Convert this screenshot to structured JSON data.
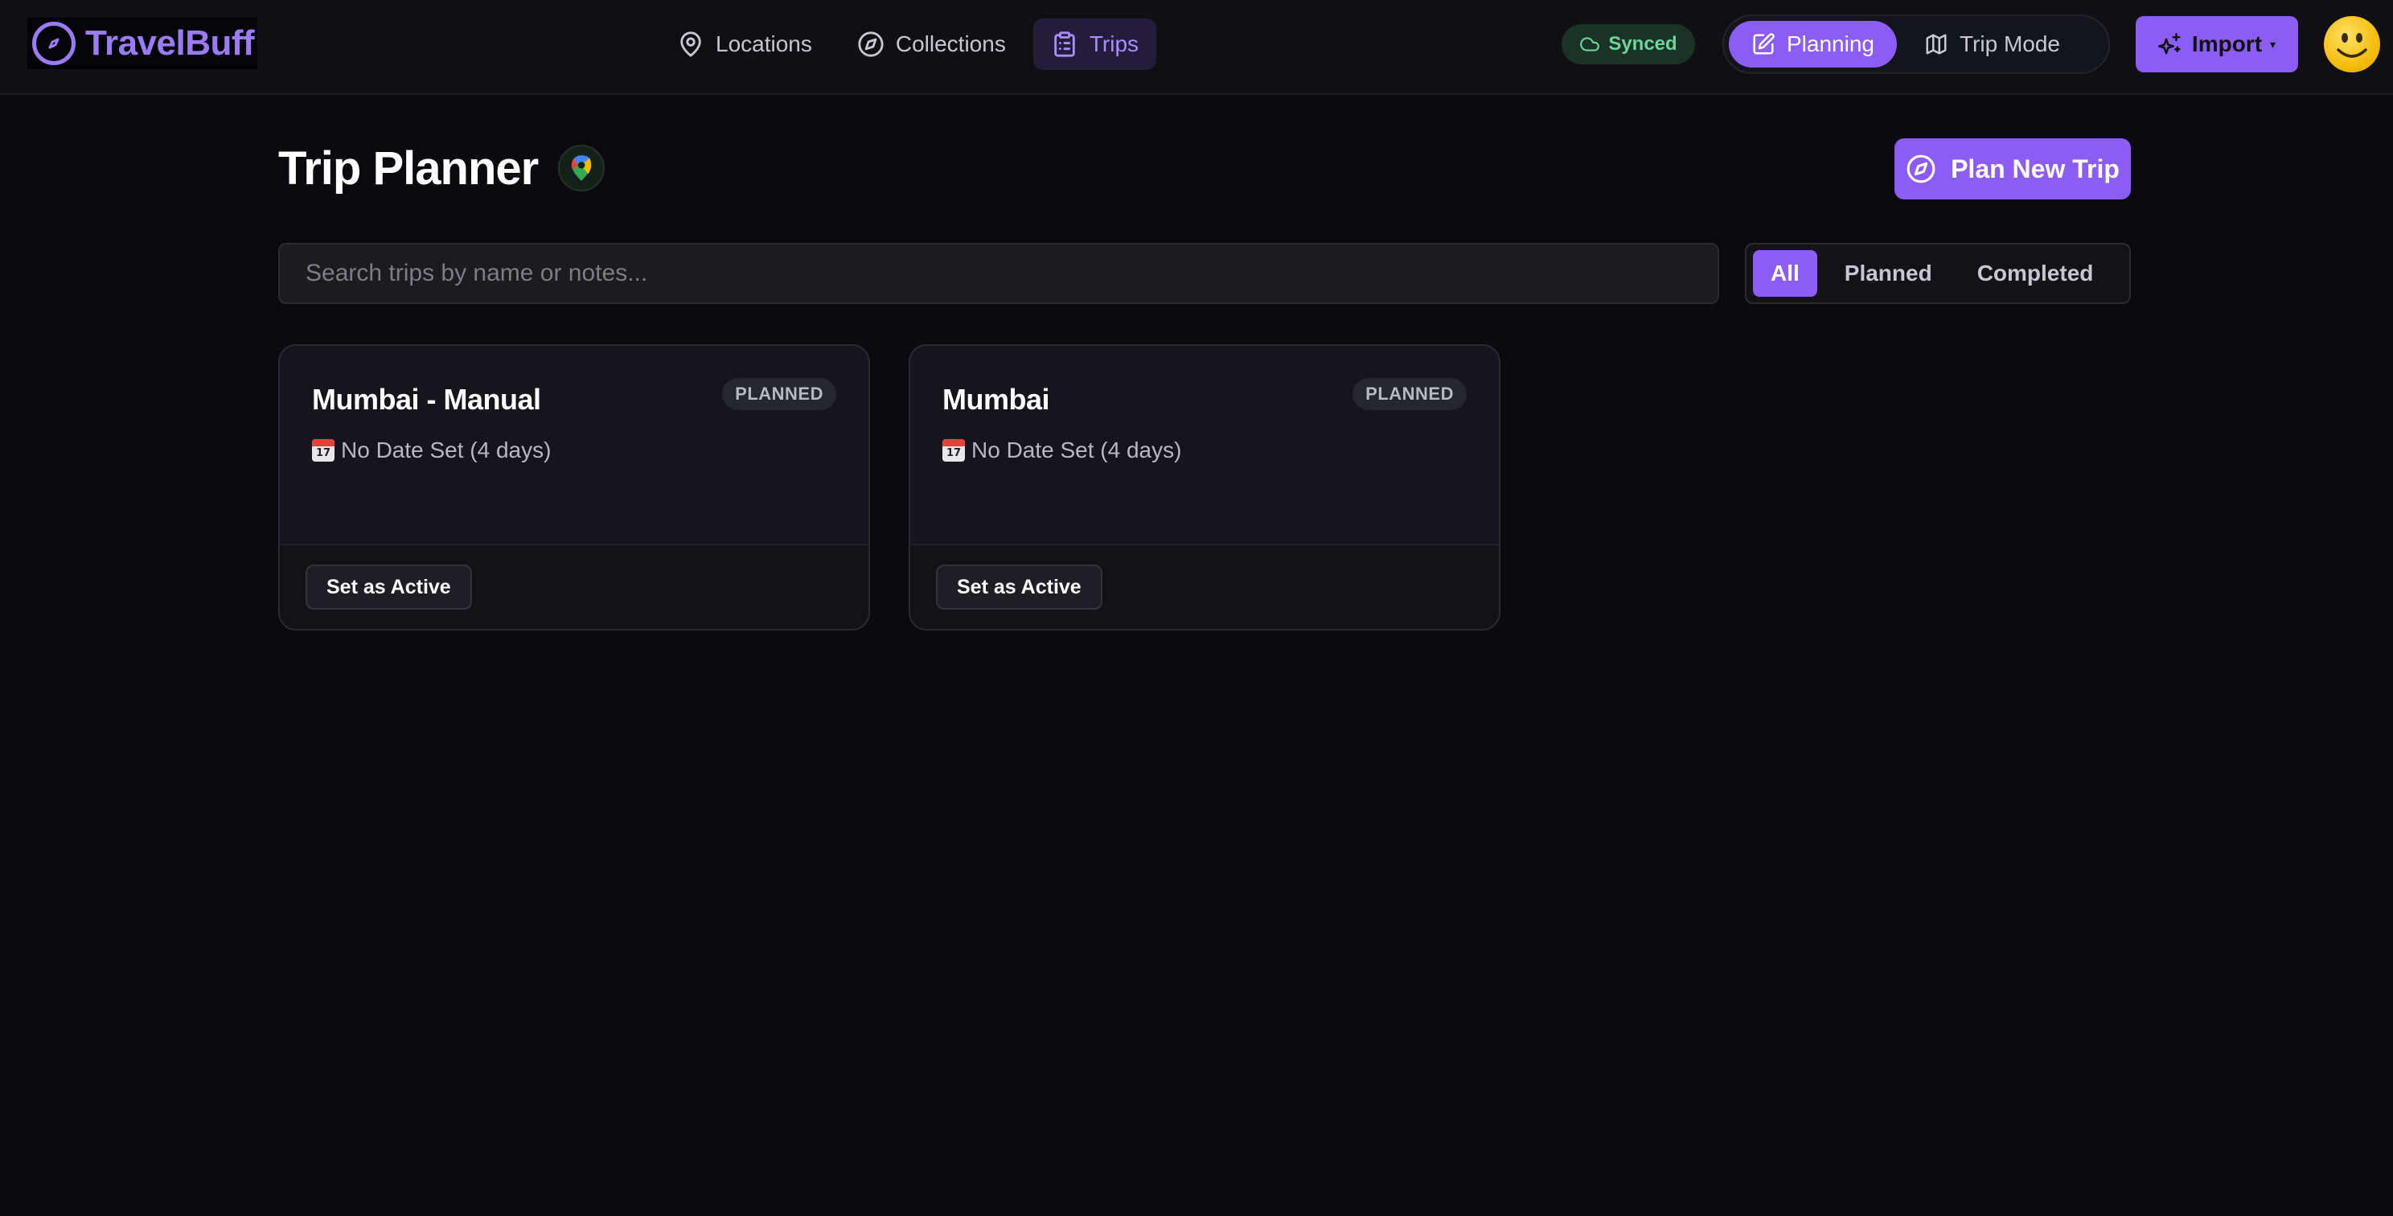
{
  "app": {
    "brand": "TravelBuff",
    "nav": [
      {
        "label": "Locations",
        "icon": "map-pin-icon"
      },
      {
        "label": "Collections",
        "icon": "compass-icon"
      },
      {
        "label": "Trips",
        "icon": "clipboard-list-icon",
        "active": true
      }
    ],
    "sync_status": "Synced",
    "modes": [
      {
        "label": "Planning",
        "icon": "edit-icon",
        "active": true
      },
      {
        "label": "Trip Mode",
        "icon": "map-icon"
      }
    ],
    "import_label": "Import",
    "import_caret": "▾"
  },
  "page": {
    "title": "Trip Planner",
    "plan_button": "Plan New Trip",
    "search_placeholder": "Search trips by name or notes...",
    "filters": [
      {
        "label": "All",
        "active": true
      },
      {
        "label": "Planned"
      },
      {
        "label": "Completed"
      }
    ]
  },
  "trips": [
    {
      "name": "Mumbai - Manual",
      "status": "PLANNED",
      "calendar_day": "17",
      "date": "No Date Set (4 days)",
      "action": "Set as Active"
    },
    {
      "name": "Mumbai",
      "status": "PLANNED",
      "calendar_day": "17",
      "date": "No Date Set (4 days)",
      "action": "Set as Active"
    }
  ],
  "colors": {
    "accent": "#8b5cf6",
    "accent_text": "#a98cff",
    "synced": "#6fd39a",
    "background": "#0b0b0f"
  }
}
